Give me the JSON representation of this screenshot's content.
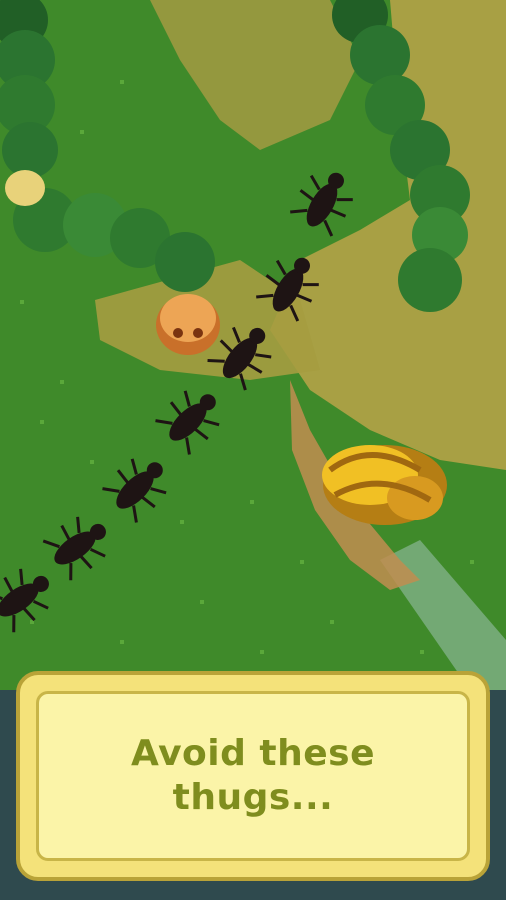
{
  "dialog": {
    "line1": "Avoid these",
    "line2": "thugs..."
  },
  "colors": {
    "grass": "#3f8a2a",
    "grass_dark": "#2f6e20",
    "dirt": "#9a9a3c",
    "bush": "#2f7a2f",
    "ant": "#1e1414",
    "bug_orange": "#e8a04a",
    "snail_yellow": "#f1c024",
    "bottom_panel": "#2f4a4e"
  },
  "icons": [
    "ant-icon",
    "orange-bug-icon",
    "snail-icon",
    "bush-icon"
  ]
}
